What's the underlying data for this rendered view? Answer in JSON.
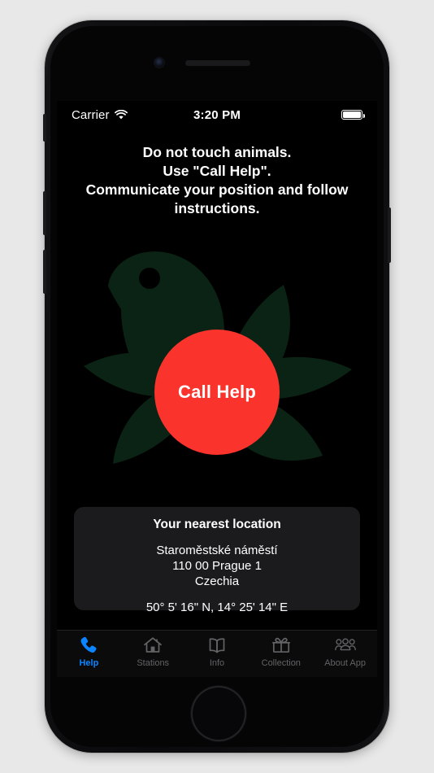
{
  "app": {
    "background_color": "#e8e8e8",
    "screen_background": "#000000"
  },
  "status_bar": {
    "carrier": "Carrier",
    "wifi_icon": "wifi-icon",
    "time": "3:20 PM",
    "battery_icon": "battery-full-icon"
  },
  "instructions": {
    "line1": "Do not touch animals.",
    "line2": "Use \"Call Help\".",
    "line3": "Communicate your position and follow",
    "line4": "instructions."
  },
  "flower": {
    "petal_color": "#0b2314",
    "bird_color": "#0b2314",
    "icon_name": "flower-with-bird-graphic"
  },
  "call_help": {
    "label": "Call Help",
    "color": "#FA342C",
    "text_color": "#ffffff"
  },
  "location_card": {
    "title": "Your nearest location",
    "address_line1": "Staroměstské náměstí",
    "address_line2": "110 00 Prague 1",
    "address_line3": "Czechia",
    "coordinates": "50° 5' 16\" N, 14° 25' 14\" E",
    "background_color": "#1b1b1d"
  },
  "tab_bar": {
    "active_color": "#0A84FF",
    "inactive_color": "#636366",
    "items": [
      {
        "label": "Help",
        "icon": "phone-icon",
        "active": true
      },
      {
        "label": "Stations",
        "icon": "house-icon",
        "active": false
      },
      {
        "label": "Info",
        "icon": "book-icon",
        "active": false
      },
      {
        "label": "Collection",
        "icon": "gift-icon",
        "active": false
      },
      {
        "label": "About App",
        "icon": "people-icon",
        "active": false
      }
    ]
  }
}
